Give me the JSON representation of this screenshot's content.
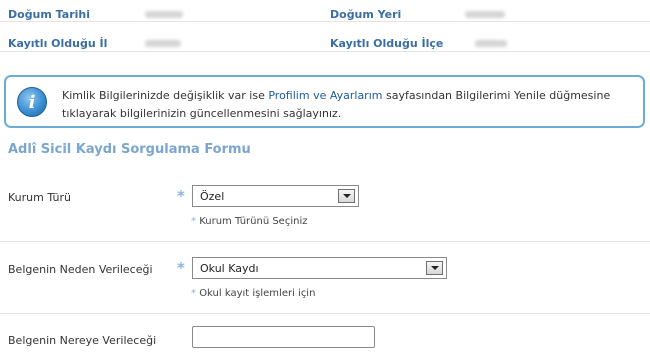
{
  "personal_info": {
    "birth_date_label": "Doğum Tarihi",
    "birth_place_label": "Doğum Yeri",
    "registered_province_label": "Kayıtlı Olduğu İl",
    "registered_district_label": "Kayıtlı Olduğu İlçe"
  },
  "notice": {
    "text_before": "Kimlik Bilgilerinizde değişiklik var ise ",
    "link": "Profilim ve Ayarlarım",
    "text_after": " sayfasından Bilgilerimi Yenile düğmesine tıklayarak bilgilerinizin güncellenmesini sağlayınız."
  },
  "form": {
    "title": "Adlî Sicil Kaydı Sorgulama Formu",
    "institution_type": {
      "label": "Kurum Türü",
      "value": "Özel",
      "hint": "Kurum Türünü Seçiniz"
    },
    "reason": {
      "label": "Belgenin Neden Verileceği",
      "value": "Okul Kaydı",
      "hint": "Okul kayıt işlemleri için"
    },
    "destination": {
      "label": "Belgenin Nereye Verileceği",
      "value": ""
    }
  },
  "colors": {
    "label_blue": "#3a6ea5",
    "notice_border": "#6aaed6",
    "title_blue": "#7aa6cf"
  }
}
